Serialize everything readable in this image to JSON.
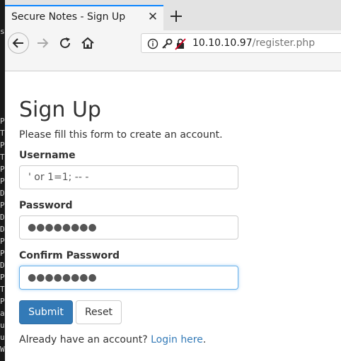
{
  "browser": {
    "tab_title": "Secure Notes - Sign Up",
    "close_tab_label": "✕",
    "url_host": "10.10.10.97",
    "url_path": "/register.php"
  },
  "terminal": {
    "lines": [
      "so",
      "P",
      "T",
      "P",
      "T",
      "P",
      "P",
      "D",
      "P",
      "D",
      "D",
      "P",
      "P",
      "D",
      "P",
      "T",
      "P",
      "a",
      "u",
      "u",
      "W"
    ]
  },
  "page": {
    "title": "Sign Up",
    "subtitle": "Please fill this form to create an account.",
    "username_label": "Username",
    "username_value": "' or 1=1; -- -",
    "password_label": "Password",
    "password_value": "●●●●●●●●",
    "confirm_label": "Confirm Password",
    "confirm_value": "●●●●●●●●",
    "submit_label": "Submit",
    "reset_label": "Reset",
    "login_prompt": "Already have an account?",
    "login_link": "Login here",
    "login_suffix": "."
  },
  "colors": {
    "primary": "#337ab7",
    "tab_accent": "#0a84ff",
    "focus": "#66afe9",
    "text": "#333333"
  }
}
